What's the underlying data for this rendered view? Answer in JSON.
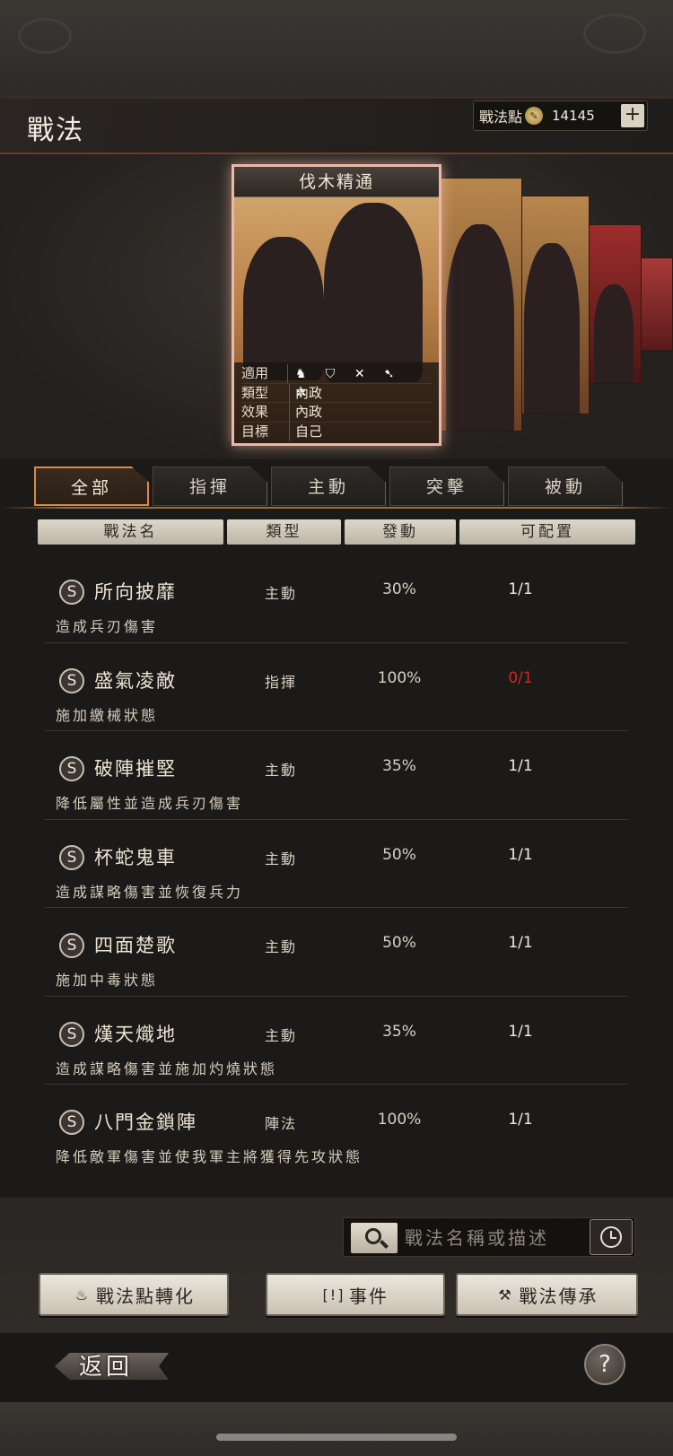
{
  "header": {
    "title": "戰法",
    "points_label": "戰法點",
    "points_value": "14145",
    "plus": "+"
  },
  "card": {
    "name": "伐木精通",
    "rows": [
      {
        "label": "適用",
        "value": ""
      },
      {
        "label": "類型",
        "value": "內政"
      },
      {
        "label": "效果",
        "value": "內政"
      },
      {
        "label": "目標",
        "value": "自己"
      }
    ],
    "unit_icons": [
      "cavalry-icon",
      "shield-icon",
      "bow-icon",
      "spear-icon",
      "wheel-icon"
    ]
  },
  "tabs": [
    {
      "label": "全部",
      "active": true
    },
    {
      "label": "指揮"
    },
    {
      "label": "主動"
    },
    {
      "label": "突擊"
    },
    {
      "label": "被動"
    }
  ],
  "columns": [
    "戰法名",
    "類型",
    "發動",
    "可配置"
  ],
  "skills": [
    {
      "grade": "S",
      "name": "所向披靡",
      "type": "主動",
      "rate": "30%",
      "config": "1/1",
      "desc": "造成兵刃傷害"
    },
    {
      "grade": "S",
      "name": "盛氣凌敵",
      "type": "指揮",
      "rate": "100%",
      "config": "0/1",
      "config_color": "#d0261f",
      "desc": "施加繳械狀態"
    },
    {
      "grade": "S",
      "name": "破陣摧堅",
      "type": "主動",
      "rate": "35%",
      "config": "1/1",
      "desc": "降低屬性並造成兵刃傷害"
    },
    {
      "grade": "S",
      "name": "杯蛇鬼車",
      "type": "主動",
      "rate": "50%",
      "config": "1/1",
      "desc": "造成謀略傷害並恢復兵力"
    },
    {
      "grade": "S",
      "name": "四面楚歌",
      "type": "主動",
      "rate": "50%",
      "config": "1/1",
      "desc": "施加中毒狀態"
    },
    {
      "grade": "S",
      "name": "熯天熾地",
      "type": "主動",
      "rate": "35%",
      "config": "1/1",
      "desc": "造成謀略傷害並施加灼燒狀態"
    },
    {
      "grade": "S",
      "name": "八門金鎖陣",
      "type": "陣法",
      "rate": "100%",
      "config": "1/1",
      "desc": "降低敵軍傷害並使我軍主將獲得先攻狀態"
    }
  ],
  "search": {
    "placeholder": "戰法名稱或描述"
  },
  "actions": [
    {
      "label": "戰法點轉化",
      "icon": "flame-icon"
    },
    {
      "label": "事件",
      "icon": "alert-icon"
    },
    {
      "label": "戰法傳承",
      "icon": "hammer-icon"
    }
  ],
  "footer": {
    "back": "返回",
    "help": "?"
  }
}
